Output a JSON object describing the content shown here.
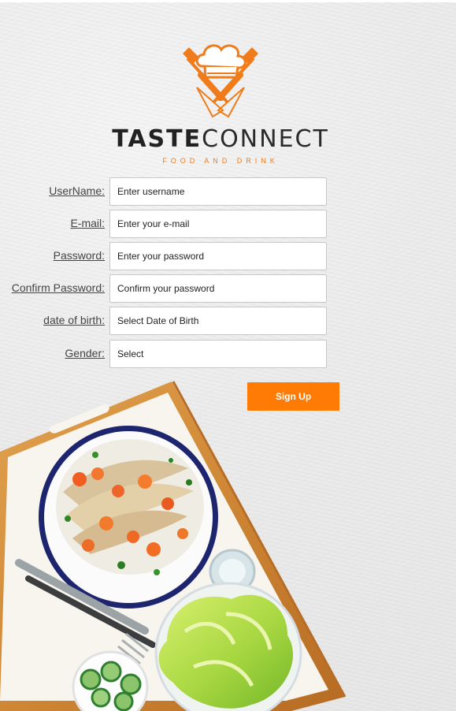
{
  "brand": {
    "name_part1": "TASTE",
    "name_part2": "CONNECT",
    "tagline": "FOOD AND DRINK",
    "accent_color": "#f07b1a",
    "logo_icon": "chef-hat-crossed-knives-icon"
  },
  "form": {
    "fields": [
      {
        "label": "UserName:",
        "value": "Enter username"
      },
      {
        "label": "E-mail:",
        "value": "Enter your e-mail"
      },
      {
        "label": "Password:",
        "value": "Enter your password"
      },
      {
        "label": "Confirm Password:",
        "value": "Confirm your password"
      },
      {
        "label": "date of birth:",
        "value": "Select Date of Birth"
      },
      {
        "label": "Gender:",
        "value": "Select"
      }
    ],
    "submit_label": "Sign Up",
    "submit_color": "#ff7b06"
  },
  "background": {
    "image": "food-tray-with-fish-salad-icon"
  }
}
